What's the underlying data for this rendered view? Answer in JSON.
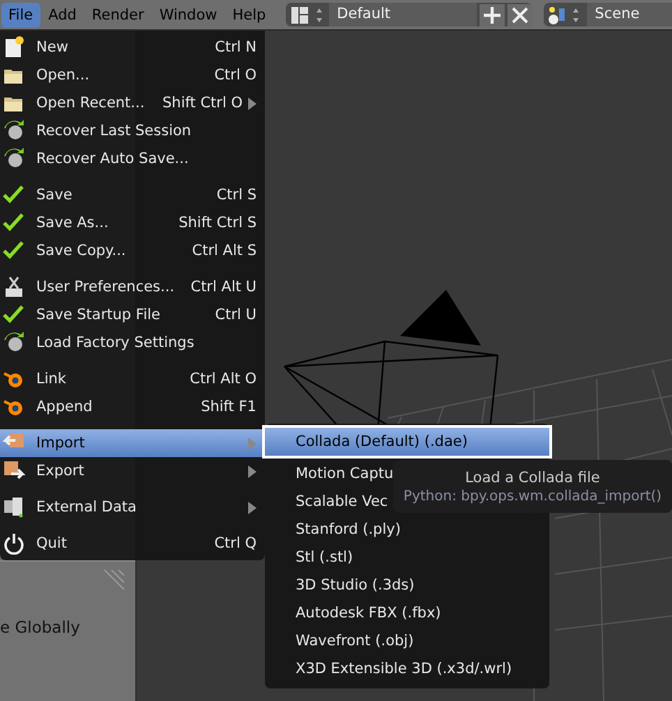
{
  "menu_bar": {
    "menus": [
      {
        "label": "File",
        "selected": true
      },
      {
        "label": "Add",
        "selected": false
      },
      {
        "label": "Render",
        "selected": false
      },
      {
        "label": "Window",
        "selected": false
      },
      {
        "label": "Help",
        "selected": false
      }
    ],
    "layout": {
      "value": "Default"
    },
    "scene": {
      "value": "Scene"
    }
  },
  "tool_panel": {
    "text": "e Globally"
  },
  "file_menu": {
    "sections": [
      [
        {
          "label": "New",
          "shortcut": "Ctrl N",
          "submenu": false,
          "selected": false
        },
        {
          "label": "Open...",
          "shortcut": "Ctrl O",
          "submenu": false,
          "selected": false
        },
        {
          "label": "Open Recent...",
          "shortcut": "Shift Ctrl O",
          "submenu": true,
          "selected": false
        },
        {
          "label": "Recover Last Session",
          "submenu": false,
          "selected": false
        },
        {
          "label": "Recover Auto Save...",
          "submenu": false,
          "selected": false
        }
      ],
      [
        {
          "label": "Save",
          "shortcut": "Ctrl S",
          "submenu": false,
          "selected": false
        },
        {
          "label": "Save As...",
          "shortcut": "Shift Ctrl S",
          "submenu": false,
          "selected": false
        },
        {
          "label": "Save Copy...",
          "shortcut": "Ctrl Alt S",
          "submenu": false,
          "selected": false
        }
      ],
      [
        {
          "label": "User Preferences...",
          "shortcut": "Ctrl Alt U",
          "submenu": false,
          "selected": false
        },
        {
          "label": "Save Startup File",
          "shortcut": "Ctrl U",
          "submenu": false,
          "selected": false
        },
        {
          "label": "Load Factory Settings",
          "submenu": false,
          "selected": false
        }
      ],
      [
        {
          "label": "Link",
          "shortcut": "Ctrl Alt O",
          "submenu": false,
          "selected": false
        },
        {
          "label": "Append",
          "shortcut": "Shift F1",
          "submenu": false,
          "selected": false
        }
      ],
      [
        {
          "label": "Import",
          "submenu": true,
          "selected": true
        },
        {
          "label": "Export",
          "submenu": true,
          "selected": false
        }
      ],
      [
        {
          "label": "External Data",
          "submenu": true,
          "selected": false
        }
      ],
      [
        {
          "label": "Quit",
          "shortcut": "Ctrl Q",
          "submenu": false,
          "selected": false
        }
      ]
    ]
  },
  "import_menu": {
    "items": [
      {
        "label": "Collada (Default) (.dae)",
        "selected": true
      },
      {
        "label": "Motion Captu",
        "selected": false
      },
      {
        "label": "Scalable Vec",
        "selected": false
      },
      {
        "label": "Stanford (.ply)",
        "selected": false
      },
      {
        "label": "Stl (.stl)",
        "selected": false
      },
      {
        "label": "3D Studio (.3ds)",
        "selected": false
      },
      {
        "label": "Autodesk FBX (.fbx)",
        "selected": false
      },
      {
        "label": "Wavefront (.obj)",
        "selected": false
      },
      {
        "label": "X3D Extensible 3D (.x3d/.wrl)",
        "selected": false
      }
    ]
  },
  "tooltip": {
    "title": "Load a Collada file",
    "python": "Python: bpy.ops.wm.collada_import()"
  }
}
